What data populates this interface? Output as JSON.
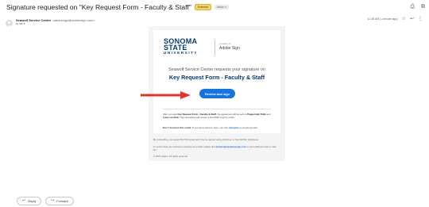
{
  "header": {
    "subject": "Signature requested on \"Key Request Form - Faculty & Staff\"",
    "badges": [
      "External",
      "Inbox ×"
    ],
    "print_icon": "⎙",
    "popout_icon": "⧉"
  },
  "message": {
    "sender_name": "Seawolf Service Center",
    "sender_address": "<adobesign@adobesign.com>",
    "to_line": "to me ▾",
    "time": "11:35 AM (1 minute ago)",
    "star_icon": "☆",
    "reply_icon": "↩",
    "more_icon": "⋮"
  },
  "email": {
    "logo_lines": [
      "SONOMA",
      "STATE",
      "UNIVERSITY"
    ],
    "powered_by": "POWERED BY",
    "adobe_sign": "Adobe Sign",
    "request_text": "Seawolf Service Center requests your signature on",
    "document_name": "Key Request Form - Faculty & Staff",
    "review_button": "Review and sign",
    "body_1": "After you sign ",
    "body_doc": "Key Request Form - Faculty & Staff",
    "body_2": ", the agreement will be sent to ",
    "body_p1": "Peppermint Polly",
    "body_3": " and ",
    "body_p2": "Lines von Pelt",
    "body_4": ". Then all parties will receive a final PDF copy by email.",
    "warn_bold": "Don't forward this email:",
    "warn_text": " If you don't want to sign, you can ",
    "warn_link": "delegate",
    "warn_end": " to someone else.",
    "footer_1": "By proceeding, you agree that this agreement may be signed using electronic or handwritten signatures.",
    "footer_2a": "To ensure that you continue receiving our emails, please add ",
    "footer_2_link": "adobesign@adobesign.com",
    "footer_2b": " to your address book or safe list.",
    "footer_3": "© 2021 Adobe. All rights reserved."
  },
  "actions": {
    "reply_label": "Reply",
    "forward_label": "Forward",
    "reply_icon": "↩",
    "forward_icon": "↪"
  },
  "colors": {
    "brand_navy": "#003b71",
    "adobe_blue": "#1473e6",
    "arrow_red": "#e5322d"
  }
}
